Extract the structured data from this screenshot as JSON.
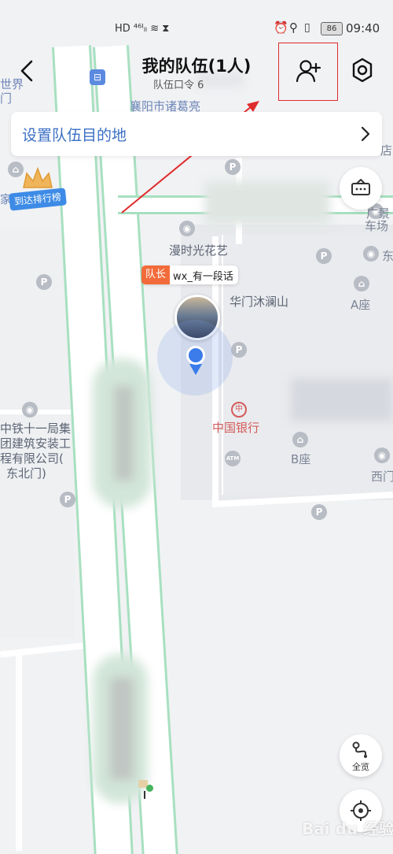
{
  "status_bar": {
    "left_icons": "HD ⁴⁶ᴵₗₗ ≋ ⧗",
    "battery": "86",
    "time": "09:40"
  },
  "header": {
    "title": "我的队伍(1人)",
    "subtitle": "队伍口令 6"
  },
  "destination": {
    "label": "设置队伍目的地"
  },
  "map": {
    "labels": {
      "zhuge": "襄阳市诸葛亮",
      "manshi": "漫时光花艺",
      "huamen": "华门沐澜山",
      "bank": "中国银行",
      "b_seat": "B座",
      "a_seat": "A座",
      "guangjing": "广景",
      "chechang": "车场",
      "dong": "东",
      "ximen": "西门",
      "dian": "店",
      "shijie": "世界",
      "men": "门",
      "yuancheng": "家城",
      "zhongtie_1": "中铁十一局集",
      "zhongtie_2": "团建筑安装工",
      "zhongtie_3": "程有限公司(",
      "zhongtie_4": "东北门)"
    },
    "rank_badge": "到达排行榜",
    "member_role": "队长",
    "member_name": "wx_有一段话"
  },
  "controls": {
    "overview_label": "全览"
  },
  "watermark": "Bai du 经验"
}
